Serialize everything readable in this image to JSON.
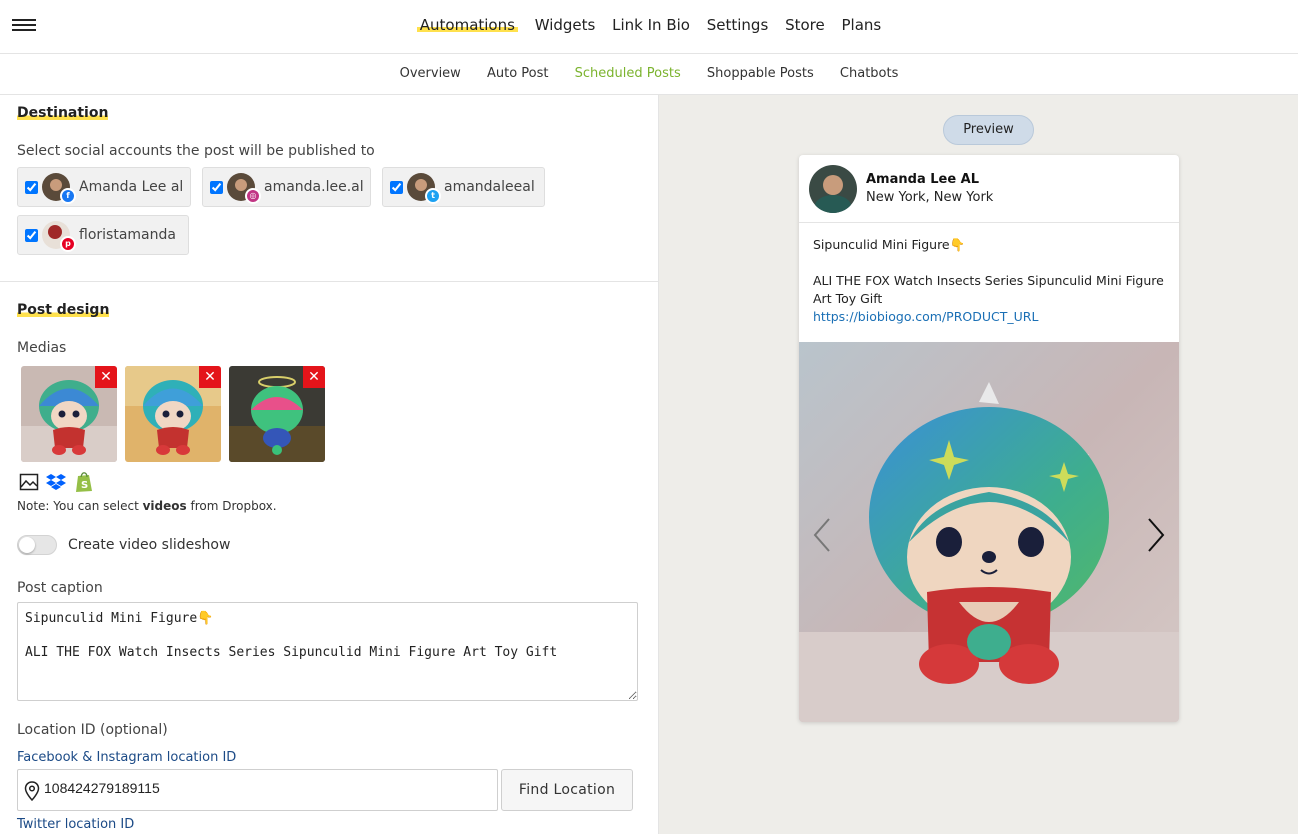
{
  "topnav": {
    "items": [
      "Automations",
      "Widgets",
      "Link In Bio",
      "Settings",
      "Store",
      "Plans"
    ],
    "active": "Automations"
  },
  "subnav": {
    "items": [
      "Overview",
      "Auto Post",
      "Scheduled Posts",
      "Shoppable Posts",
      "Chatbots"
    ],
    "active": "Scheduled Posts"
  },
  "destination": {
    "title": "Destination",
    "description": "Select social accounts the post will be published to",
    "accounts": [
      {
        "name": "Amanda Lee al",
        "network": "facebook-icon",
        "checked": true,
        "color": "#1877f2"
      },
      {
        "name": "amanda.lee.al",
        "network": "instagram-icon",
        "checked": true,
        "color": "#c13584"
      },
      {
        "name": "amandaleeal",
        "network": "twitter-icon",
        "checked": true,
        "color": "#1da1f2"
      },
      {
        "name": "floristamanda",
        "network": "pinterest-icon",
        "checked": true,
        "color": "#e60023"
      }
    ]
  },
  "post_design": {
    "title": "Post design",
    "medias_label": "Medias",
    "media_icons": [
      "image-icon",
      "dropbox-icon",
      "shopify-icon"
    ],
    "note_prefix": "Note: You can select ",
    "note_bold": "videos",
    "note_suffix": " from Dropbox.",
    "slideshow_label": "Create video slideshow",
    "slideshow_enabled": false,
    "caption_label": "Post caption",
    "caption_value": "Sipunculid Mini Figure👇\n\nALI THE FOX Watch Insects Series Sipunculid Mini Figure Art Toy Gift",
    "location_label": "Location ID (optional)",
    "fb_ig_location_label": "Facebook & Instagram location ID",
    "location_value": "108424279189115",
    "find_location_label": "Find Location",
    "twitter_location_label": "Twitter location ID"
  },
  "preview": {
    "button_label": "Preview",
    "user_name": "Amanda Lee AL",
    "user_location": "New York, New York",
    "caption_title": "Sipunculid Mini Figure👇",
    "caption_body": "ALI THE FOX Watch Insects Series Sipunculid Mini Figure Art Toy Gift",
    "caption_link": "https://biobiogo.com/PRODUCT_URL"
  },
  "colors": {
    "accent_highlight": "#ffe14d",
    "active_subnav": "#7bb32e",
    "remove_button": "#e4141a",
    "link": "#1a6fb5"
  }
}
